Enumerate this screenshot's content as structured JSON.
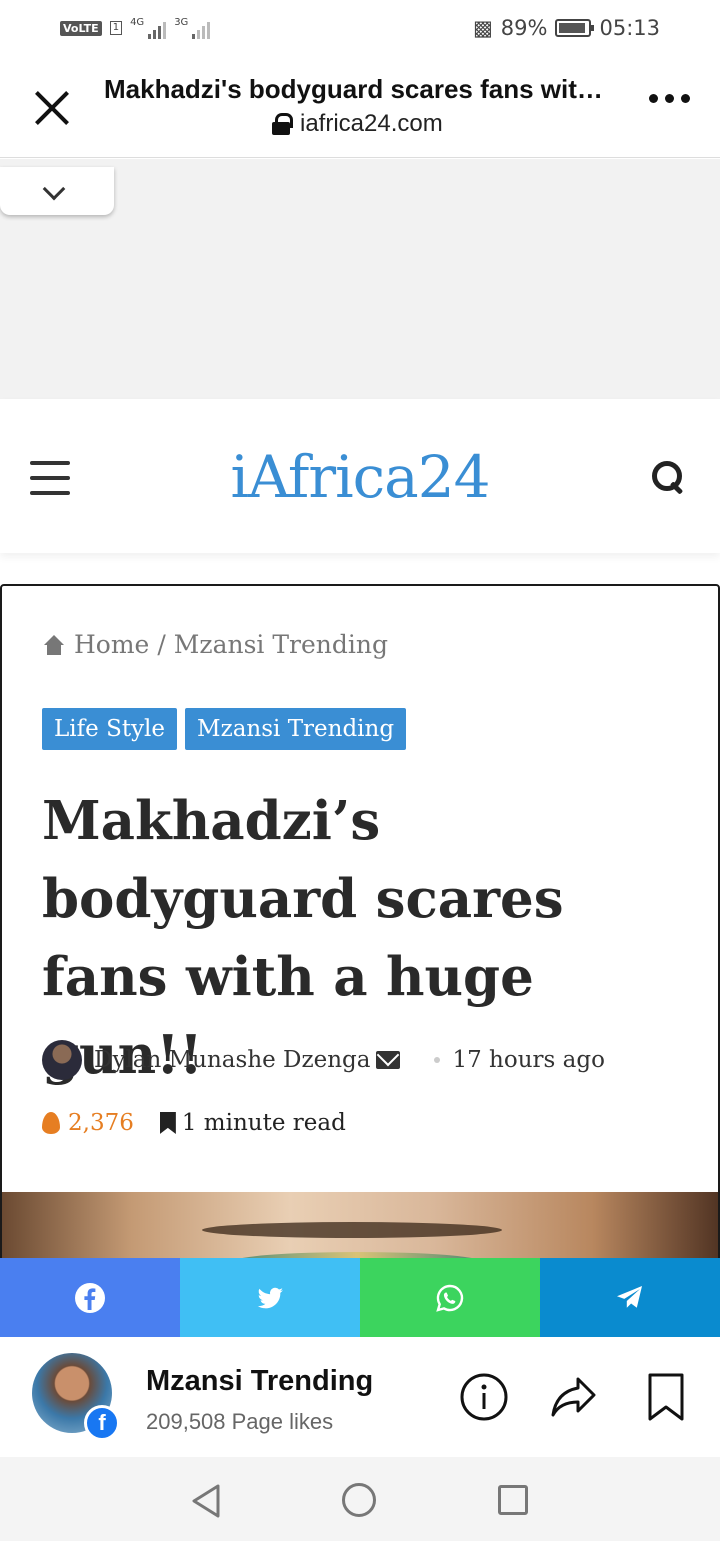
{
  "status_bar": {
    "volte": "VoLTE",
    "sim1": "1",
    "net1": "4G",
    "net2": "3G",
    "battery": "89%",
    "time": "05:13"
  },
  "browser": {
    "page_title": "Makhadzi's bodyguard scares fans with...",
    "url": "iafrica24.com"
  },
  "site": {
    "logo": "iAfrica24"
  },
  "article": {
    "breadcrumb_home": "Home",
    "breadcrumb_sep": "/",
    "breadcrumb_current": "Mzansi Trending",
    "categories": [
      "Life Style",
      "Mzansi Trending"
    ],
    "headline": "Makhadzi’s bodyguard scares fans with a huge gun!!",
    "author": "Dylan Munashe Dzenga",
    "time_ago": "17 hours ago",
    "views": "2,376",
    "read_time": "1 minute read"
  },
  "share": {
    "icons": [
      "facebook-icon",
      "twitter-icon",
      "whatsapp-icon",
      "telegram-icon"
    ],
    "colors": {
      "facebook": "#4a7ff0",
      "twitter": "#40bff4",
      "whatsapp": "#3cd45e",
      "telegram": "#0a8bcf"
    }
  },
  "fb_footer": {
    "page_name": "Mzansi Trending",
    "page_likes": "209,508 Page likes"
  },
  "colors": {
    "accent": "#3a8ed4",
    "views": "#e67e22"
  }
}
